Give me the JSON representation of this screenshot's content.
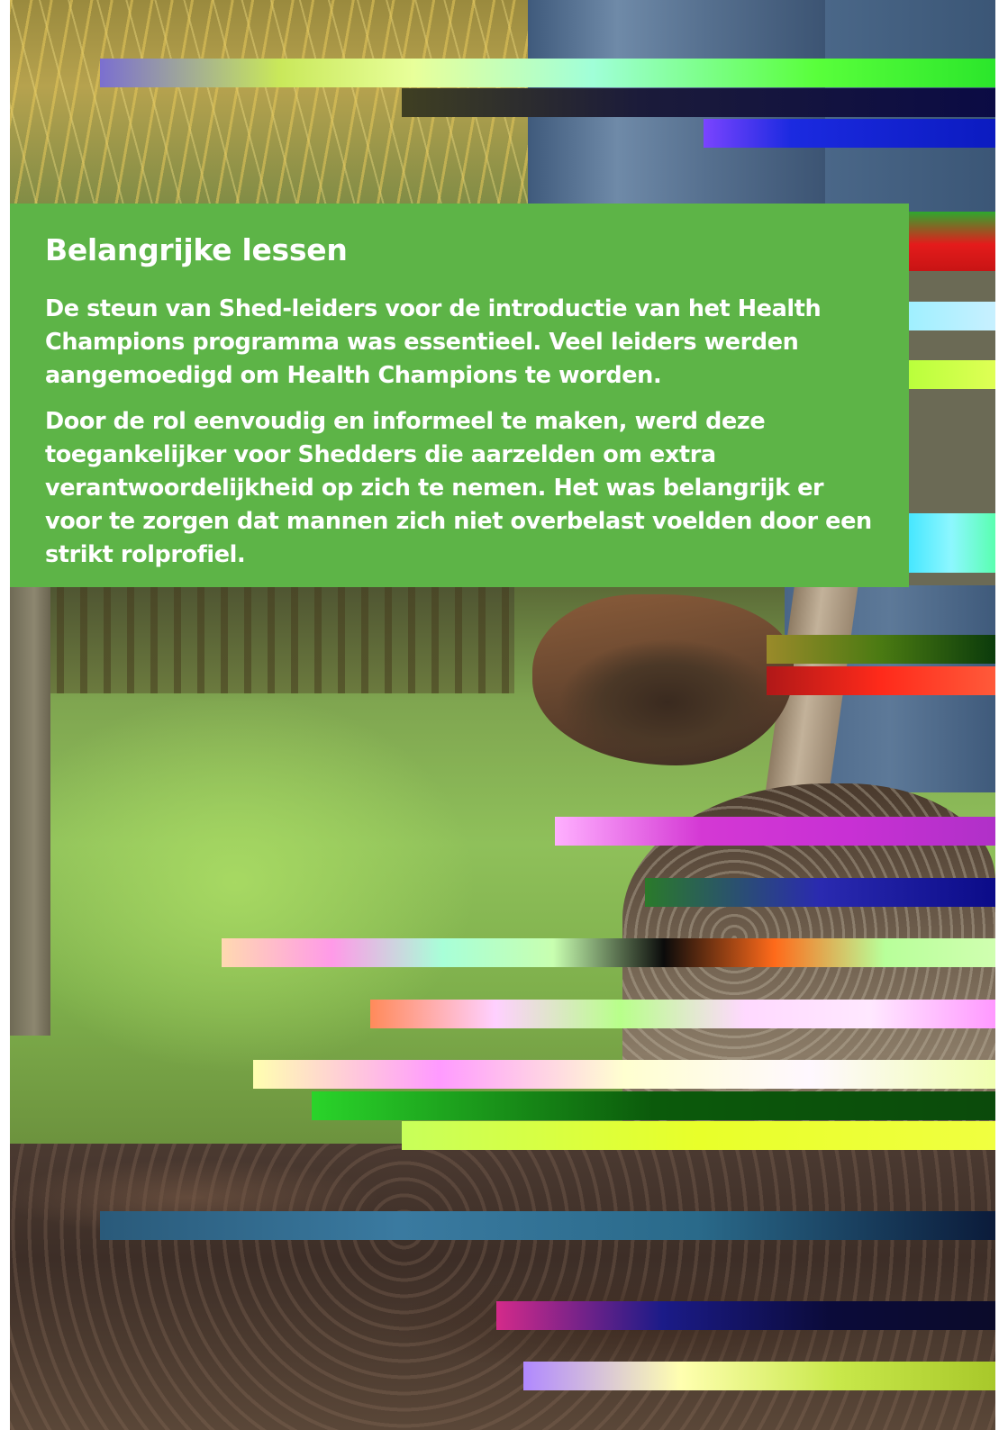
{
  "panel": {
    "heading": "Belangrijke lessen",
    "paragraphs": [
      "De steun van Shed-leiders voor de introductie van het Health Champions programma was essentieel. Veel leiders werden aangemoedigd om Health Champions te worden.",
      "Door de rol eenvoudig en informeel te maken, werd deze toegankelijker voor Shedders die aarzelden om extra verantwoordelijkheid op zich te nemen. Het was belangrijk er voor te zorgen dat mannen zich niet overbelast voelden door een strikt rolprofiel."
    ]
  },
  "photo": {
    "subject": "boot-stepping-on-spade-in-garden-soil"
  },
  "colors": {
    "panel_background": "#5db447",
    "panel_text": "#ffffff"
  }
}
